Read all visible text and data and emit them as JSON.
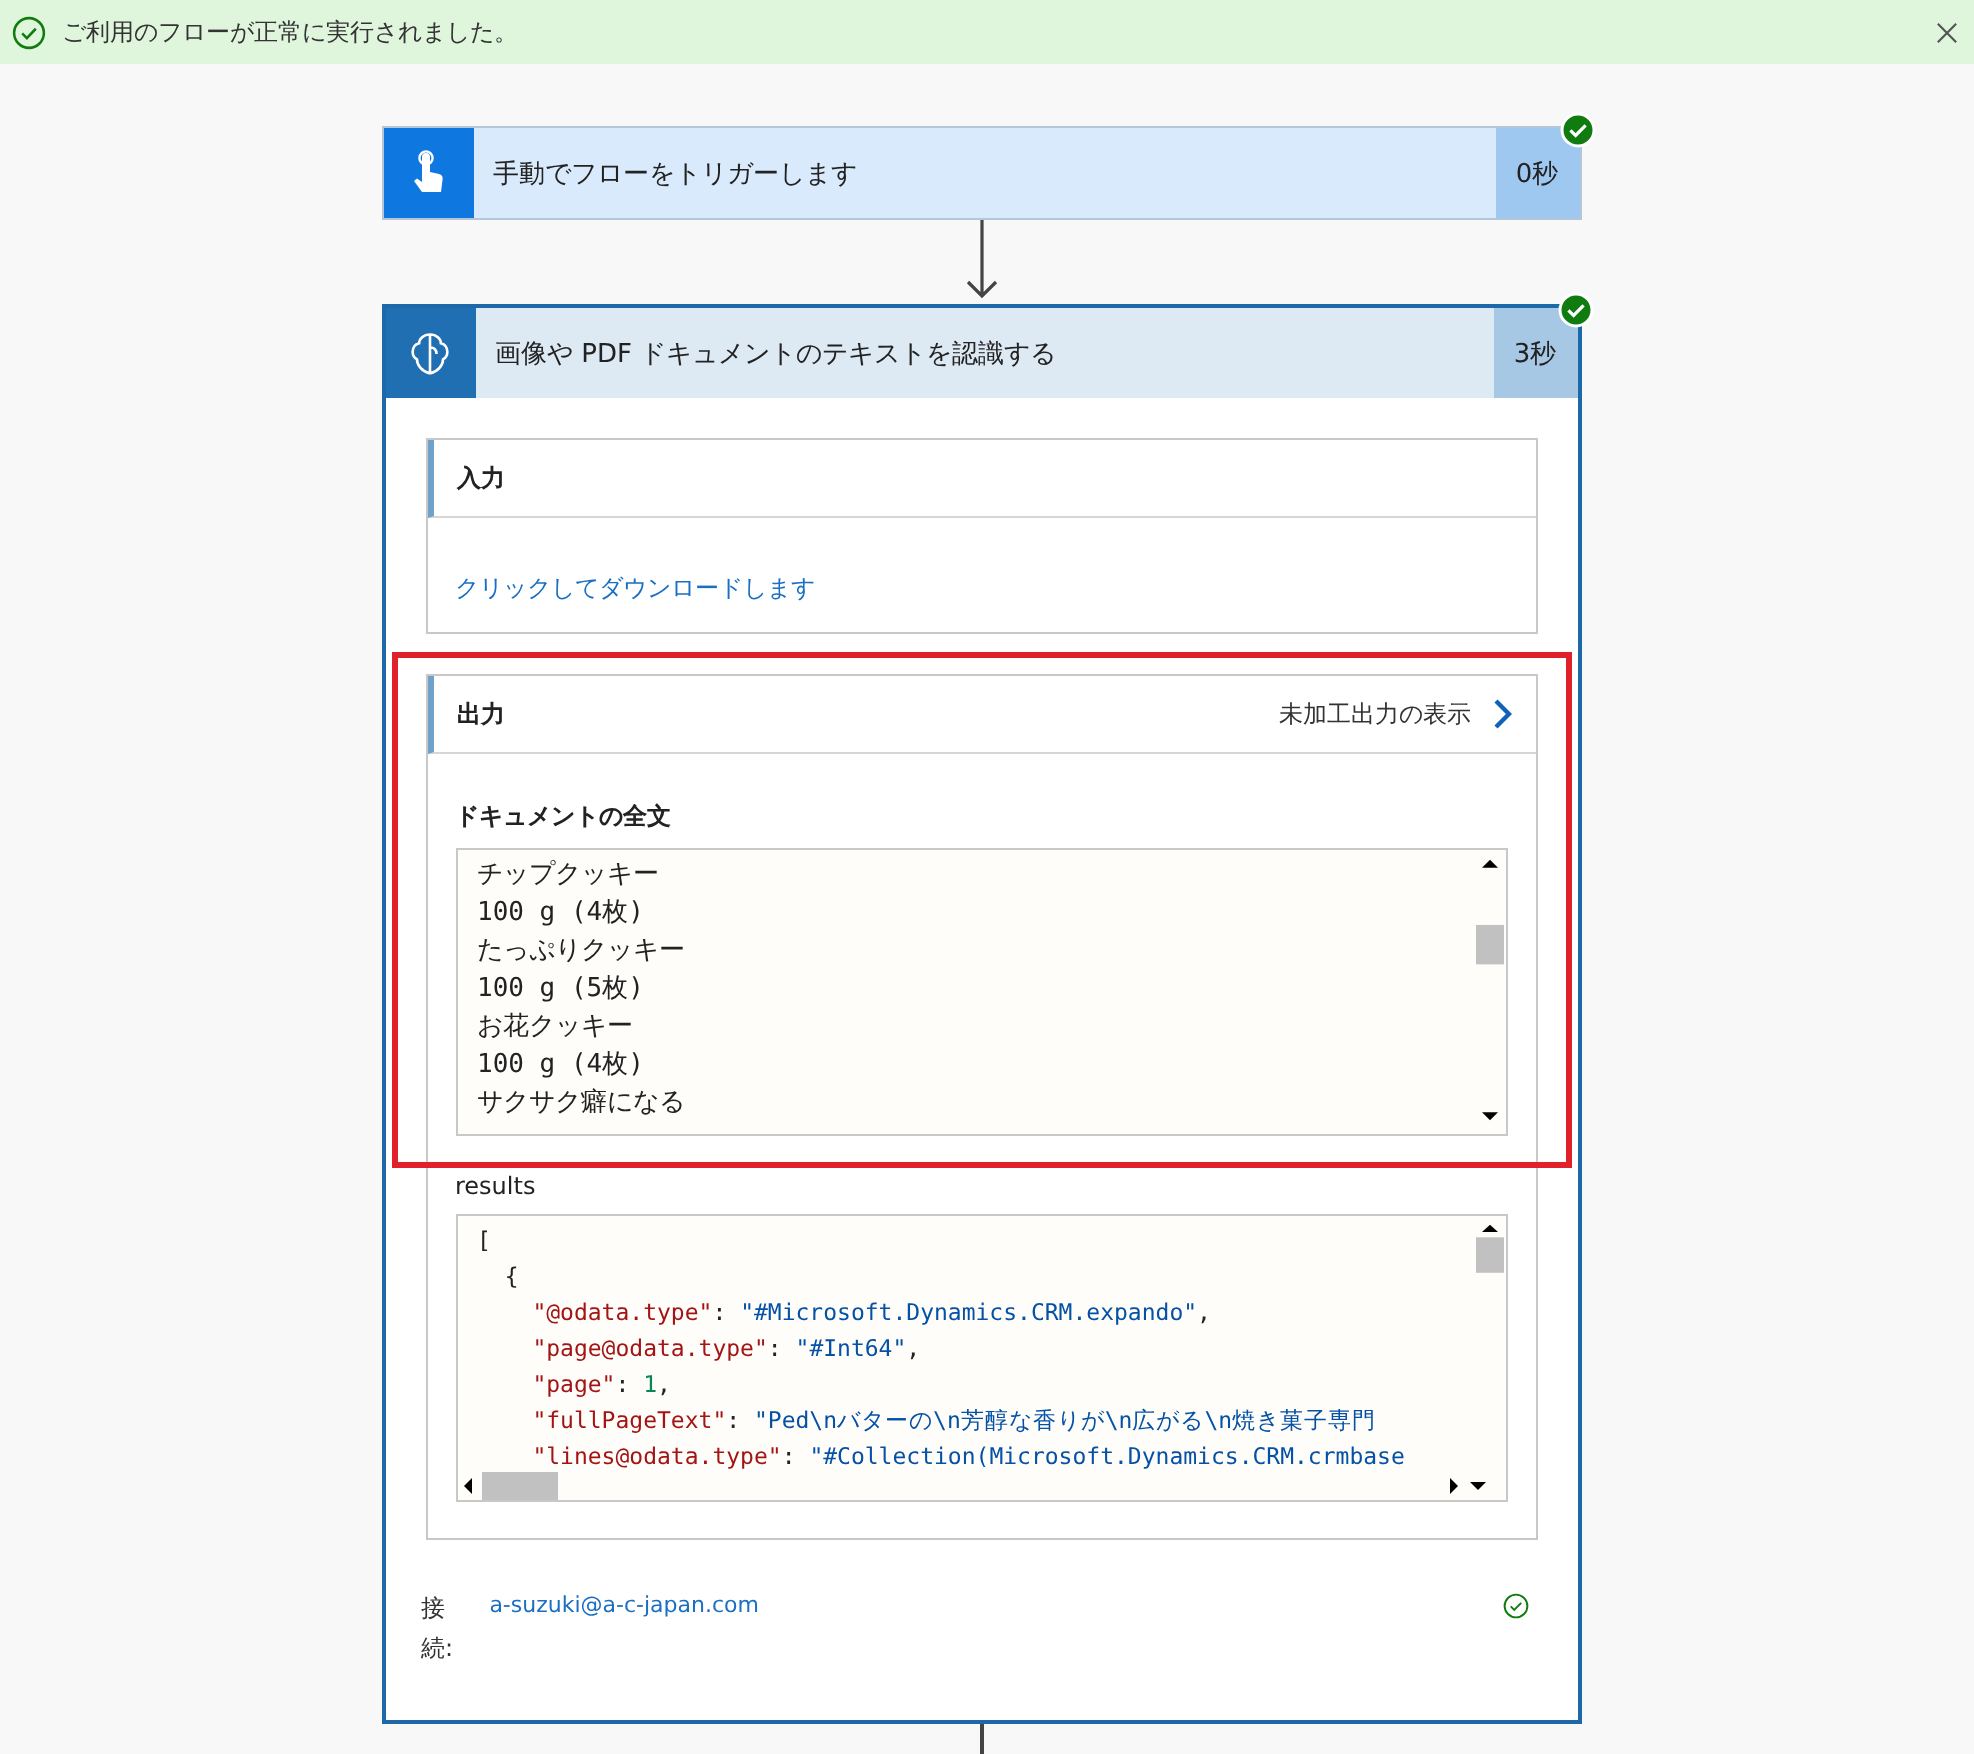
{
  "banner": {
    "message": "ご利用のフローが正常に実行されました。",
    "success": true
  },
  "steps": [
    {
      "kind": "trigger",
      "title": "手動でフローをトリガーします",
      "duration": "0秒",
      "succeeded": true,
      "expanded": false
    },
    {
      "kind": "ai",
      "title": "画像や PDF ドキュメントのテキストを認識する",
      "duration": "3秒",
      "succeeded": true,
      "expanded": true,
      "input": {
        "title": "入力",
        "link": "クリックしてダウンロードします"
      },
      "output": {
        "title": "出力",
        "raw_link": "未加工出力の表示",
        "highlighted": true,
        "full_text": {
          "label": "ドキュメントの全文",
          "lines": [
            "チップクッキー",
            "100 g (4枚)",
            "たっぷりクッキー",
            "100 g (5枚)",
            "お花クッキー",
            "100 g (4枚)",
            "サクサク癖になる"
          ]
        },
        "results": {
          "label": "results",
          "lines": [
            [
              {
                "kind": "punct",
                "text": "["
              }
            ],
            [
              {
                "kind": "punct",
                "text": "  {"
              }
            ],
            [
              {
                "kind": "key",
                "text": "    \"@odata.type\""
              },
              {
                "kind": "punct",
                "text": ": "
              },
              {
                "kind": "string",
                "text": "\"#Microsoft.Dynamics.CRM.expando\""
              },
              {
                "kind": "punct",
                "text": ","
              }
            ],
            [
              {
                "kind": "key",
                "text": "    \"page@odata.type\""
              },
              {
                "kind": "punct",
                "text": ": "
              },
              {
                "kind": "string",
                "text": "\"#Int64\""
              },
              {
                "kind": "punct",
                "text": ","
              }
            ],
            [
              {
                "kind": "key",
                "text": "    \"page\""
              },
              {
                "kind": "punct",
                "text": ": "
              },
              {
                "kind": "number",
                "text": "1"
              },
              {
                "kind": "punct",
                "text": ","
              }
            ],
            [
              {
                "kind": "key",
                "text": "    \"fullPageText\""
              },
              {
                "kind": "punct",
                "text": ": "
              },
              {
                "kind": "string",
                "text": "\"Ped\\nバターの\\n芳醇な香りが\\n広がる\\n焼き菓子専門"
              }
            ],
            [
              {
                "kind": "key",
                "text": "    \"lines@odata.type\""
              },
              {
                "kind": "punct",
                "text": ": "
              },
              {
                "kind": "string",
                "text": "\"#Collection(Microsoft.Dynamics.CRM.crmbase"
              }
            ]
          ]
        }
      },
      "connection": {
        "label": "接続:",
        "account": "a-suzuki@a-c-japan.com",
        "connected": true
      }
    }
  ]
}
